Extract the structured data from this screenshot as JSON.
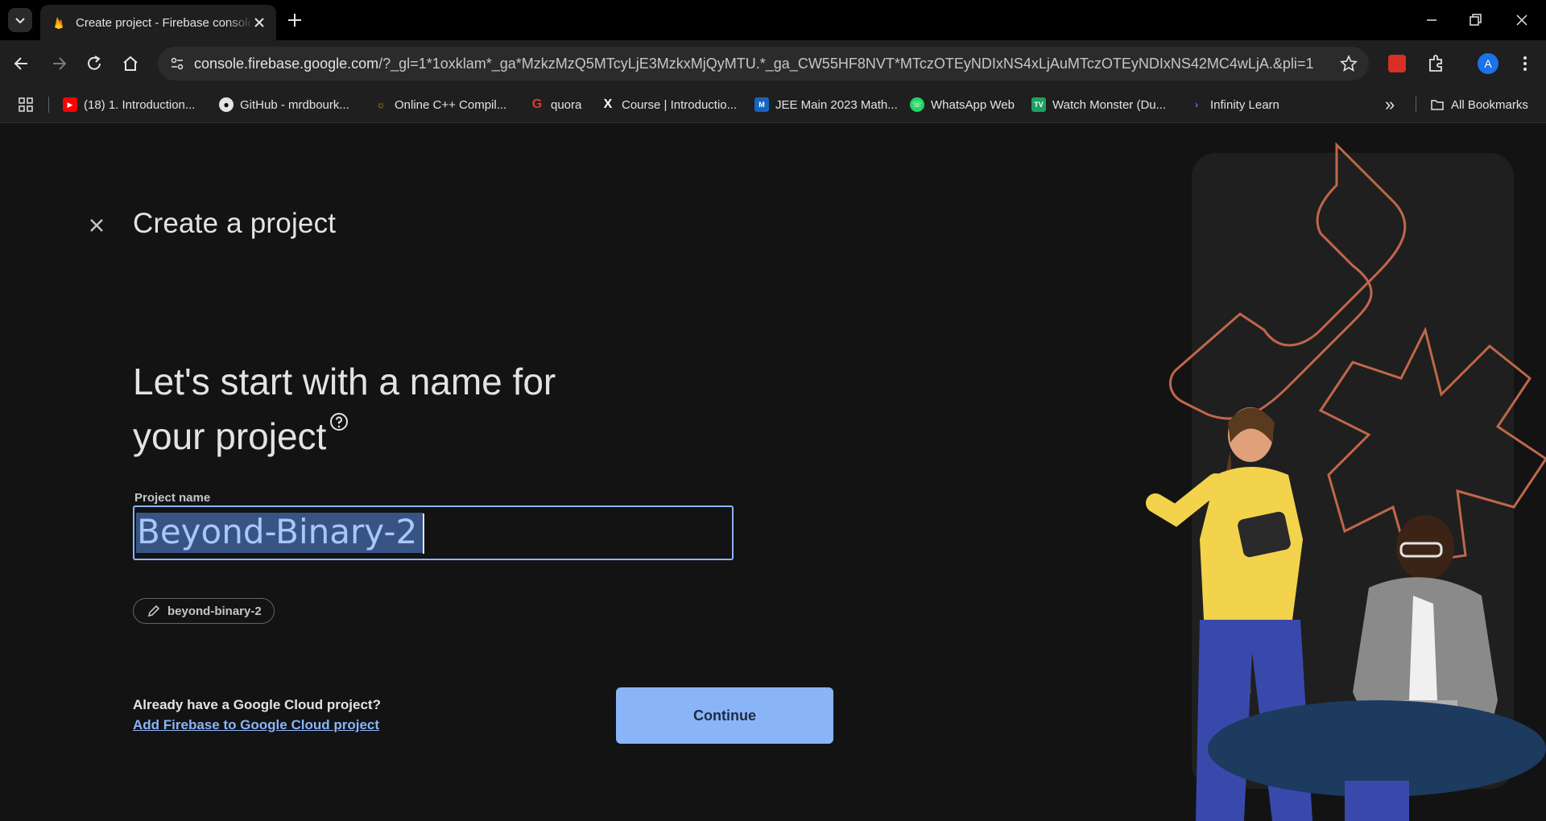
{
  "browser": {
    "tab_title": "Create project - Firebase console",
    "url_host": "console.firebase.google.com",
    "url_rest": "/?_gl=1*1oxklam*_ga*MzkzMzQ5MTcyLjE3MzkxMjQyMTU.*_ga_CW55HF8NVT*MTczOTEyNDIxNS4xLjAuMTczOTEyNDIxNS42MC4wLjA.&pli=1",
    "profile_initial": "A",
    "bookmarks": [
      {
        "label": "(18) 1. Introduction...",
        "icon": "youtube-icon"
      },
      {
        "label": "GitHub - mrdbourk...",
        "icon": "github-icon"
      },
      {
        "label": "Online C++ Compil...",
        "icon": "compiler-icon"
      },
      {
        "label": "quora",
        "icon": "quora-icon"
      },
      {
        "label": "Course | Introductio...",
        "icon": "course-icon"
      },
      {
        "label": "JEE Main 2023 Math...",
        "icon": "jee-icon"
      },
      {
        "label": "WhatsApp Web",
        "icon": "whatsapp-icon"
      },
      {
        "label": "Watch Monster (Du...",
        "icon": "tv-icon"
      },
      {
        "label": "Infinity Learn",
        "icon": "infinity-learn-icon"
      }
    ],
    "all_bookmarks": "All Bookmarks"
  },
  "page": {
    "title": "Create a project",
    "heading_line1": "Let's start with a name for",
    "heading_line2": "your project",
    "field_label": "Project name",
    "field_value": "Beyond-Binary-2",
    "project_id_chip": "beyond-binary-2",
    "already_text": "Already have a Google Cloud project?",
    "add_link": "Add Firebase to Google Cloud project",
    "continue_label": "Continue"
  },
  "colors": {
    "background": "#131314",
    "accent": "#8ab4f8",
    "illustration_line": "#c0674a"
  }
}
